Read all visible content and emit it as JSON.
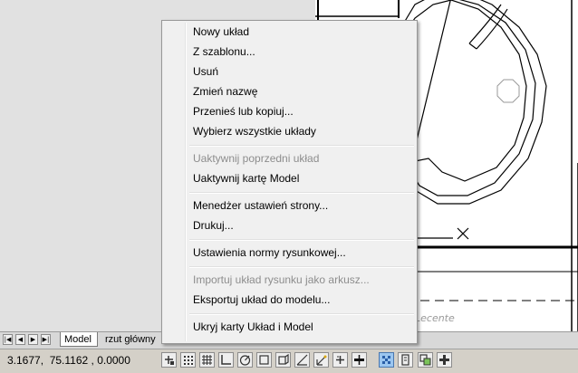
{
  "context_menu": {
    "items": [
      {
        "label": "Nowy układ",
        "enabled": true
      },
      {
        "label": "Z szablonu...",
        "enabled": true
      },
      {
        "label": "Usuń",
        "enabled": true
      },
      {
        "label": "Zmień nazwę",
        "enabled": true
      },
      {
        "label": "Przenieś lub kopiuj...",
        "enabled": true
      },
      {
        "label": "Wybierz wszystkie układy",
        "enabled": true
      },
      {
        "label": "Uaktywnij poprzedni układ",
        "enabled": false
      },
      {
        "label": "Uaktywnij kartę Model",
        "enabled": true
      },
      {
        "label": "Menedżer ustawień strony...",
        "enabled": true
      },
      {
        "label": "Drukuj...",
        "enabled": true
      },
      {
        "label": "Ustawienia normy rysunkowej...",
        "enabled": true
      },
      {
        "label": "Importuj układ rysunku jako arkusz...",
        "enabled": false
      },
      {
        "label": "Eksportuj układ do modelu...",
        "enabled": true
      },
      {
        "label": "Ukryj karty Układ i Model",
        "enabled": true
      }
    ]
  },
  "drawing": {
    "partial_text": "Lecente"
  },
  "tabs": {
    "model": "Model",
    "layout": "rzut główny"
  },
  "status_bar": {
    "coordinates": "3.1677,  75.1162 , 0.0000"
  },
  "colors": {
    "menu_background": "#f0f0f0",
    "disabled_text": "#8d8d8d",
    "status_toggle_on": "#9bc6f0"
  }
}
